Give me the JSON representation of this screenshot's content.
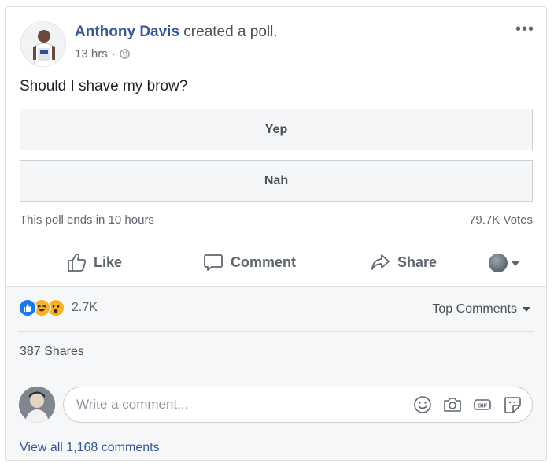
{
  "post": {
    "author": "Anthony Davis",
    "action": " created a poll.",
    "time": "13 hrs",
    "separator": "·",
    "more": "•••",
    "question": "Should I shave my brow?"
  },
  "poll": {
    "options": [
      "Yep",
      "Nah"
    ],
    "ends": "This poll ends in 10 hours",
    "votes": "79.7K Votes"
  },
  "actions": {
    "like": "Like",
    "comment": "Comment",
    "share": "Share"
  },
  "engagement": {
    "reaction_count": "2.7K",
    "top_comments": "Top Comments",
    "shares": "387 Shares",
    "view_all": "View all 1,168 comments"
  },
  "composer": {
    "placeholder": "Write a comment..."
  },
  "colors": {
    "link": "#365899",
    "like_blue": "#1877f2",
    "emoji_yellow": "#f7b125"
  },
  "icons": [
    "globe-icon",
    "thumbs-up-icon",
    "comment-icon",
    "share-arrow-icon",
    "smiley-icon",
    "camera-icon",
    "gif-icon",
    "sticker-icon"
  ]
}
